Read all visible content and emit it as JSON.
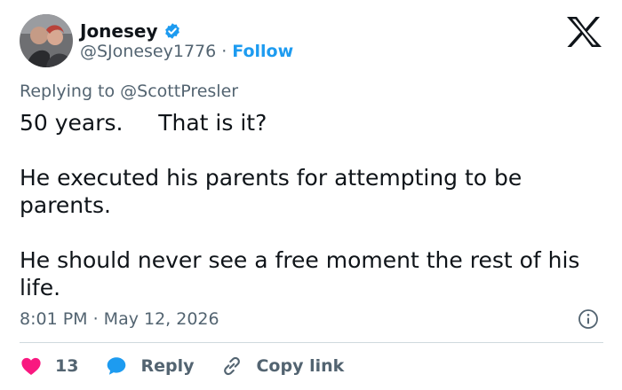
{
  "author": {
    "name": "Jonesey",
    "handle": "@SJonesey1776",
    "separator": "·",
    "follow_label": "Follow"
  },
  "replying": {
    "prefix": "Replying to",
    "mention": "@ScottPresler"
  },
  "tweet": {
    "line1": "50 years.     That is it?",
    "para2": "He executed his parents for attempting to be parents.",
    "para3": "He should never see a free moment the rest of his life."
  },
  "timestamp": "8:01 PM · May 12, 2026",
  "actions": {
    "likes_count": "13",
    "reply_label": "Reply",
    "copy_link_label": "Copy link"
  },
  "colors": {
    "link_blue": "#1d9bf0",
    "like_red": "#f91880",
    "muted": "#536471",
    "text": "#0f1419",
    "divider": "#cfd9de"
  },
  "icons": [
    "verified-badge-icon",
    "x-logo-icon",
    "info-icon",
    "heart-icon",
    "reply-bubble-icon",
    "link-icon"
  ]
}
